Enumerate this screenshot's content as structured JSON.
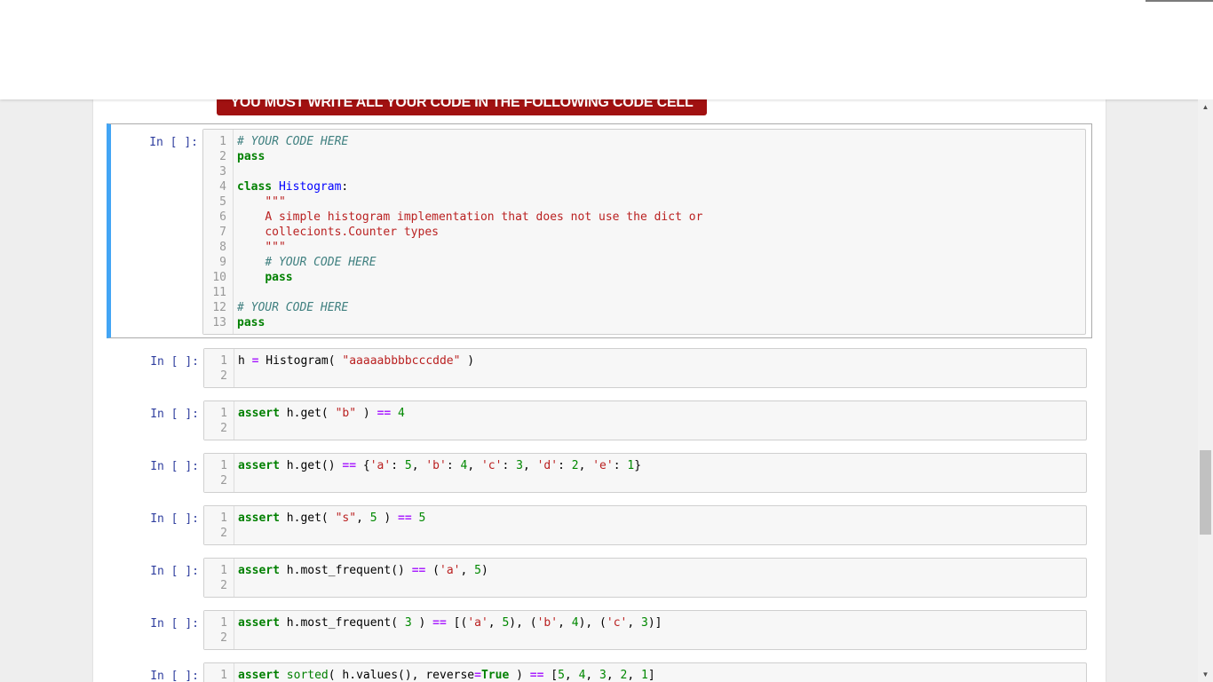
{
  "banner": {
    "text": "YOU MUST WRITE ALL YOUR CODE IN THE FOLLOWING CODE CELL"
  },
  "cells": [
    {
      "prompt": "In [ ]:",
      "selected": true,
      "lines": [
        [
          [
            "# YOUR CODE HERE",
            "comment"
          ]
        ],
        [
          [
            "pass",
            "keyword"
          ]
        ],
        [],
        [
          [
            "class",
            "keyword"
          ],
          [
            " ",
            ""
          ],
          [
            "Histogram",
            "def"
          ],
          [
            ":",
            ""
          ]
        ],
        [
          [
            "    ",
            ""
          ],
          [
            "\"\"\"",
            "string"
          ]
        ],
        [
          [
            "    ",
            ""
          ],
          [
            "A simple histogram implementation that does not use the dict or",
            "string"
          ]
        ],
        [
          [
            "    ",
            ""
          ],
          [
            "collecionts.Counter types",
            "string"
          ]
        ],
        [
          [
            "    ",
            ""
          ],
          [
            "\"\"\"",
            "string"
          ]
        ],
        [
          [
            "    ",
            ""
          ],
          [
            "# YOUR CODE HERE",
            "comment"
          ]
        ],
        [
          [
            "    ",
            ""
          ],
          [
            "pass",
            "keyword"
          ]
        ],
        [],
        [
          [
            "# YOUR CODE HERE",
            "comment"
          ]
        ],
        [
          [
            "pass",
            "keyword"
          ]
        ]
      ]
    },
    {
      "prompt": "In [ ]:",
      "selected": false,
      "lines": [
        [
          [
            "h",
            ""
          ],
          [
            " ",
            ""
          ],
          [
            "=",
            "operator"
          ],
          [
            " Histogram( ",
            ""
          ],
          [
            "\"aaaaabbbbcccdde\"",
            "string"
          ],
          [
            " )",
            ""
          ]
        ],
        []
      ]
    },
    {
      "prompt": "In [ ]:",
      "selected": false,
      "lines": [
        [
          [
            "assert",
            "keyword"
          ],
          [
            " h.get( ",
            ""
          ],
          [
            "\"b\"",
            "string"
          ],
          [
            " ) ",
            ""
          ],
          [
            "==",
            "operator"
          ],
          [
            " ",
            ""
          ],
          [
            "4",
            "number"
          ]
        ],
        []
      ]
    },
    {
      "prompt": "In [ ]:",
      "selected": false,
      "lines": [
        [
          [
            "assert",
            "keyword"
          ],
          [
            " h.get() ",
            ""
          ],
          [
            "==",
            "operator"
          ],
          [
            " {",
            ""
          ],
          [
            "'a'",
            "string"
          ],
          [
            ": ",
            ""
          ],
          [
            "5",
            "number"
          ],
          [
            ", ",
            ""
          ],
          [
            "'b'",
            "string"
          ],
          [
            ": ",
            ""
          ],
          [
            "4",
            "number"
          ],
          [
            ", ",
            ""
          ],
          [
            "'c'",
            "string"
          ],
          [
            ": ",
            ""
          ],
          [
            "3",
            "number"
          ],
          [
            ", ",
            ""
          ],
          [
            "'d'",
            "string"
          ],
          [
            ": ",
            ""
          ],
          [
            "2",
            "number"
          ],
          [
            ", ",
            ""
          ],
          [
            "'e'",
            "string"
          ],
          [
            ": ",
            ""
          ],
          [
            "1",
            "number"
          ],
          [
            "}",
            ""
          ]
        ],
        []
      ]
    },
    {
      "prompt": "In [ ]:",
      "selected": false,
      "lines": [
        [
          [
            "assert",
            "keyword"
          ],
          [
            " h.get( ",
            ""
          ],
          [
            "\"s\"",
            "string"
          ],
          [
            ", ",
            ""
          ],
          [
            "5",
            "number"
          ],
          [
            " ) ",
            ""
          ],
          [
            "==",
            "operator"
          ],
          [
            " ",
            ""
          ],
          [
            "5",
            "number"
          ]
        ],
        []
      ]
    },
    {
      "prompt": "In [ ]:",
      "selected": false,
      "lines": [
        [
          [
            "assert",
            "keyword"
          ],
          [
            " h.most_frequent() ",
            ""
          ],
          [
            "==",
            "operator"
          ],
          [
            " (",
            ""
          ],
          [
            "'a'",
            "string"
          ],
          [
            ", ",
            ""
          ],
          [
            "5",
            "number"
          ],
          [
            ")",
            ""
          ]
        ],
        []
      ]
    },
    {
      "prompt": "In [ ]:",
      "selected": false,
      "lines": [
        [
          [
            "assert",
            "keyword"
          ],
          [
            " h.most_frequent( ",
            ""
          ],
          [
            "3",
            "number"
          ],
          [
            " ) ",
            ""
          ],
          [
            "==",
            "operator"
          ],
          [
            " [(",
            ""
          ],
          [
            "'a'",
            "string"
          ],
          [
            ", ",
            ""
          ],
          [
            "5",
            "number"
          ],
          [
            "), (",
            ""
          ],
          [
            "'b'",
            "string"
          ],
          [
            ", ",
            ""
          ],
          [
            "4",
            "number"
          ],
          [
            "), (",
            ""
          ],
          [
            "'c'",
            "string"
          ],
          [
            ", ",
            ""
          ],
          [
            "3",
            "number"
          ],
          [
            ")]",
            ""
          ]
        ],
        []
      ]
    },
    {
      "prompt": "In [ ]:",
      "selected": false,
      "lines": [
        [
          [
            "assert",
            "keyword"
          ],
          [
            " ",
            ""
          ],
          [
            "sorted",
            "builtin"
          ],
          [
            "( h.values(), reverse",
            ""
          ],
          [
            "=",
            "operator"
          ],
          [
            "True",
            "keyword"
          ],
          [
            " ) ",
            ""
          ],
          [
            "==",
            "operator"
          ],
          [
            " [",
            ""
          ],
          [
            "5",
            "number"
          ],
          [
            ", ",
            ""
          ],
          [
            "4",
            "number"
          ],
          [
            ", ",
            ""
          ],
          [
            "3",
            "number"
          ],
          [
            ", ",
            ""
          ],
          [
            "2",
            "number"
          ],
          [
            ", ",
            ""
          ],
          [
            "1",
            "number"
          ],
          [
            "]",
            ""
          ]
        ],
        []
      ]
    }
  ],
  "scrollbar": {
    "up_glyph": "▲",
    "down_glyph": "▼"
  },
  "colors": {
    "banner_bg": "#a11111",
    "selected_cell_border": "#42a5f5",
    "prompt_text": "#303f9f"
  }
}
